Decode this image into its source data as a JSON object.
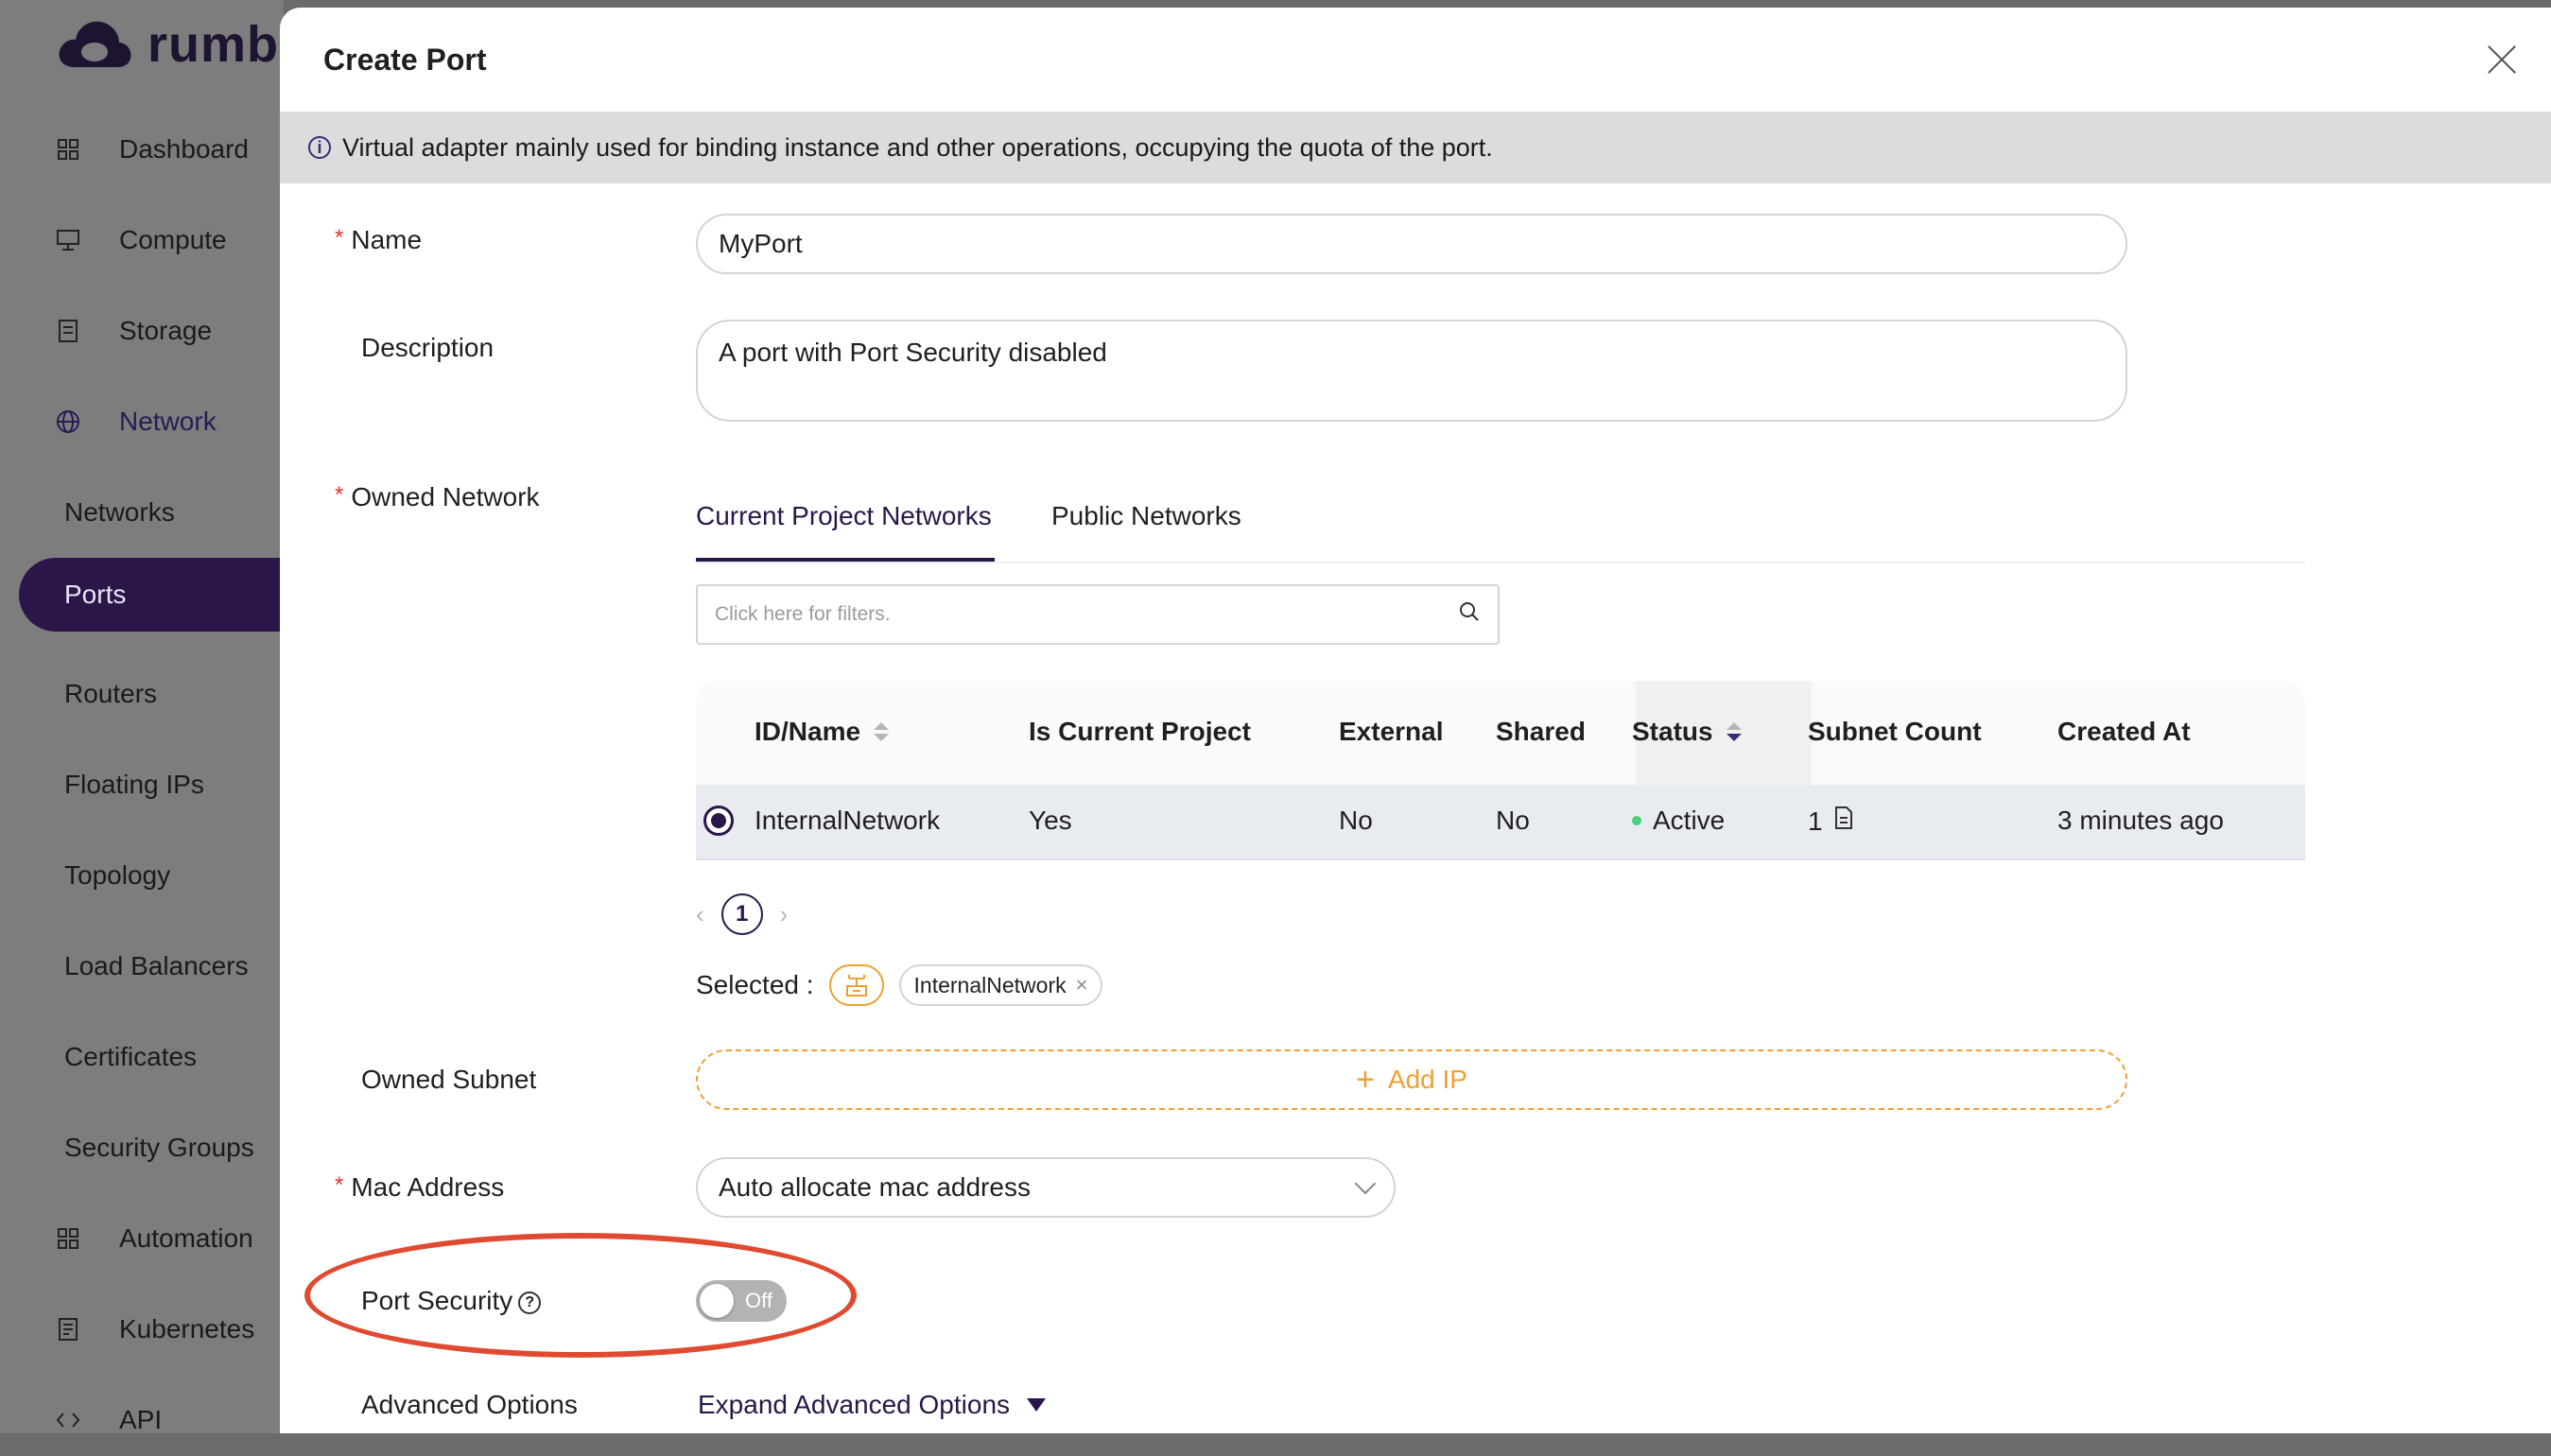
{
  "app": {
    "logo_text": "rumbl",
    "brand_color": "#2a1648"
  },
  "sidebar": {
    "items": [
      {
        "label": "Dashboard",
        "icon": "grid-icon"
      },
      {
        "label": "Compute",
        "icon": "monitor-icon"
      },
      {
        "label": "Storage",
        "icon": "storage-icon"
      },
      {
        "label": "Network",
        "icon": "globe-icon"
      },
      {
        "label": "Networks"
      },
      {
        "label": "Ports"
      },
      {
        "label": "Routers"
      },
      {
        "label": "Floating IPs"
      },
      {
        "label": "Topology"
      },
      {
        "label": "Load Balancers"
      },
      {
        "label": "Certificates"
      },
      {
        "label": "Security Groups"
      },
      {
        "label": "Automation",
        "icon": "grid-icon"
      },
      {
        "label": "Kubernetes",
        "icon": "document-icon"
      },
      {
        "label": "API",
        "icon": "code-icon"
      }
    ]
  },
  "modal": {
    "title": "Create Port",
    "info": "Virtual adapter mainly used for binding instance and other operations, occupying the quota of the port.",
    "name": {
      "label": "Name",
      "value": "MyPort"
    },
    "description": {
      "label": "Description",
      "value": "A port with Port Security disabled"
    },
    "owned_network": {
      "label": "Owned Network",
      "tabs": [
        "Current Project Networks",
        "Public Networks"
      ],
      "filter_placeholder": "Click here for filters.",
      "columns": [
        "ID/Name",
        "Is Current Project",
        "External",
        "Shared",
        "Status",
        "Subnet Count",
        "Created At"
      ],
      "rows": [
        {
          "name": "InternalNetwork",
          "current": "Yes",
          "external": "No",
          "shared": "No",
          "status": "Active",
          "subnet_count": "1",
          "created": "3 minutes ago"
        }
      ],
      "page": "1",
      "selected_label": "Selected :",
      "selected_tag": "InternalNetwork"
    },
    "owned_subnet": {
      "label": "Owned Subnet",
      "add_ip": "Add IP"
    },
    "mac_address": {
      "label": "Mac Address",
      "value": "Auto allocate mac address"
    },
    "port_security": {
      "label": "Port Security",
      "toggle_text": "Off"
    },
    "advanced": {
      "label": "Advanced Options",
      "link": "Expand Advanced Options"
    }
  }
}
